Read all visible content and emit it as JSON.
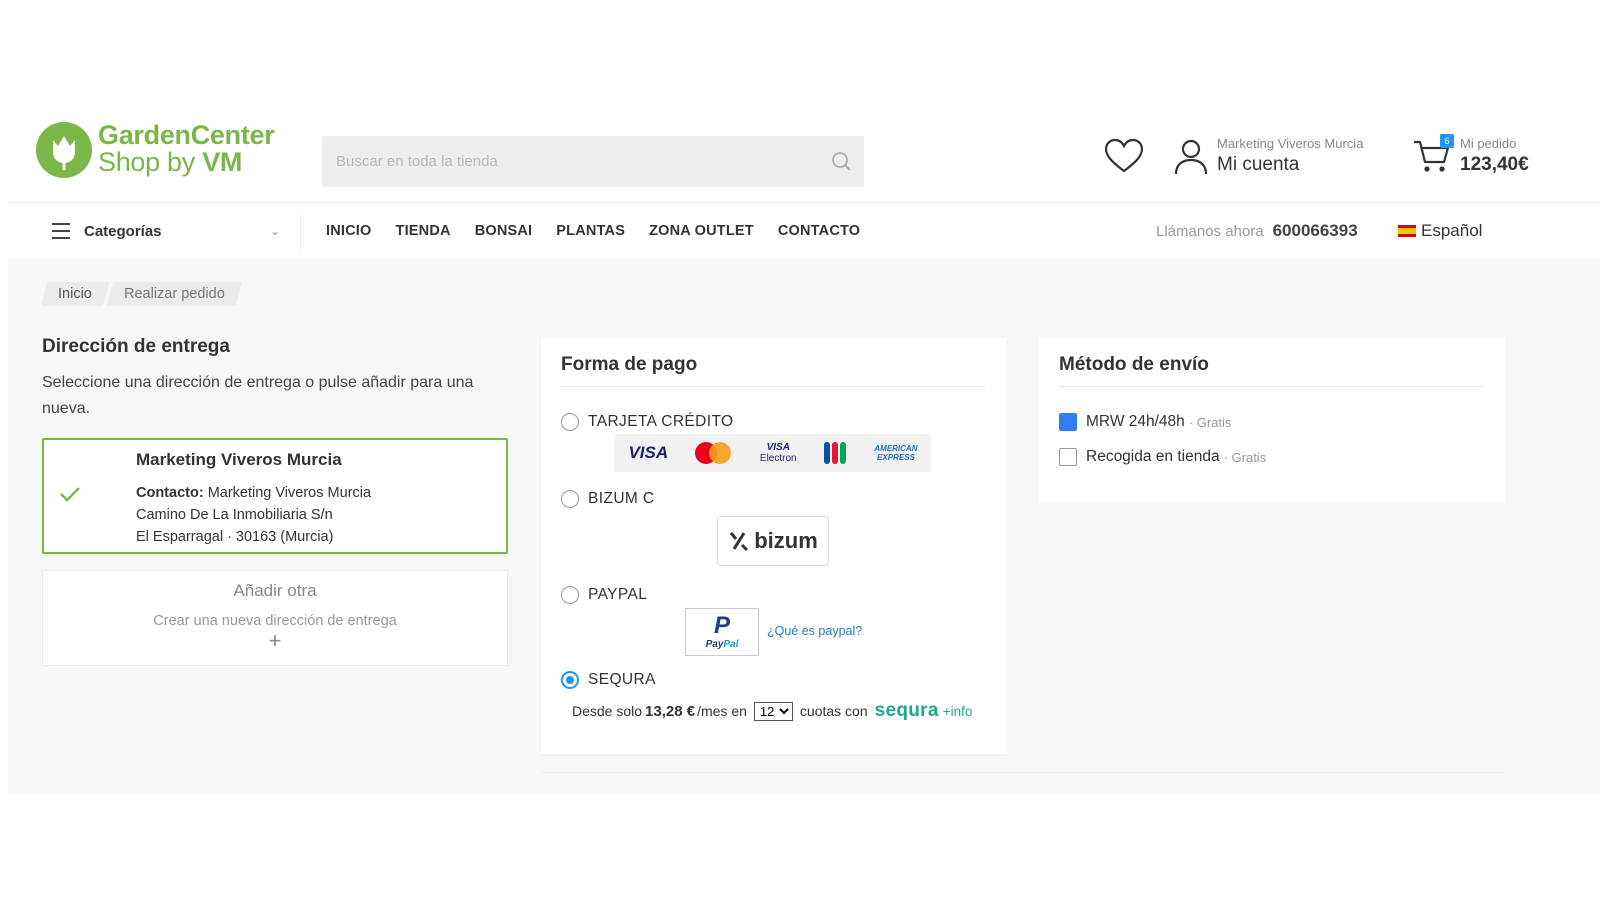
{
  "header": {
    "logo_line1": "GardenCenter",
    "logo_line2_a": "Shop by ",
    "logo_line2_b": "VM",
    "search_placeholder": "Buscar en toda la tienda",
    "account_small": "Marketing Viveros Murcia",
    "account_big": "Mi cuenta",
    "cart_count": "6",
    "cart_small": "Mi pedido",
    "cart_total": "123,40€"
  },
  "nav": {
    "categories_label": "Categorías",
    "menu": [
      "INICIO",
      "TIENDA",
      "BONSAI",
      "PLANTAS",
      "ZONA OUTLET",
      "CONTACTO"
    ],
    "call_label": "Llámanos ahora",
    "phone": "600066393",
    "language": "Español"
  },
  "breadcrumb": [
    "Inicio",
    "Realizar pedido"
  ],
  "delivery": {
    "title": "Dirección de entrega",
    "description": "Seleccione una dirección de entrega o pulse añadir para una nueva.",
    "address": {
      "name": "Marketing Viveros Murcia",
      "contact_label": "Contacto:",
      "contact_value": "Marketing Viveros Murcia",
      "street": "Camino De La Inmobiliaria S/n",
      "city": "El Esparragal · 30163 (Murcia)"
    },
    "add_other": {
      "title": "Añadir otra",
      "subtitle": "Crear una nueva dirección de entrega",
      "plus": "+"
    }
  },
  "payment": {
    "title": "Forma de pago",
    "options": [
      "TARJETA CRÉDITO",
      "BIZUM C",
      "PAYPAL",
      "SEQURA"
    ],
    "selected": "SEQURA",
    "cards": {
      "visa": "VISA",
      "visa_electron_1": "VISA",
      "visa_electron_2": "Electron",
      "amex_1": "AMERICAN",
      "amex_2": "EXPRESS"
    },
    "bizum_text": "bizum",
    "paypal_logo_p": "P",
    "paypal_logo_a": "Pay",
    "paypal_logo_b": "Pal",
    "paypal_link": "¿Qué es paypal?",
    "sequra": {
      "prefix": "Desde solo",
      "amount": "13,28 €",
      "per_month": "/mes en",
      "installments_selected": "12",
      "suffix": "cuotas con",
      "brand": "sequra",
      "info": "+info"
    }
  },
  "shipping": {
    "title": "Método de envío",
    "options": [
      {
        "name": "MRW 24h/48h",
        "price": "· Gratis",
        "checked": true
      },
      {
        "name": "Recogida en tienda",
        "price": "· Gratis",
        "checked": false
      }
    ]
  },
  "colors": {
    "brand_green": "#7ab648",
    "accent_blue": "#2196f3",
    "sequra_green": "#1ea58e"
  }
}
